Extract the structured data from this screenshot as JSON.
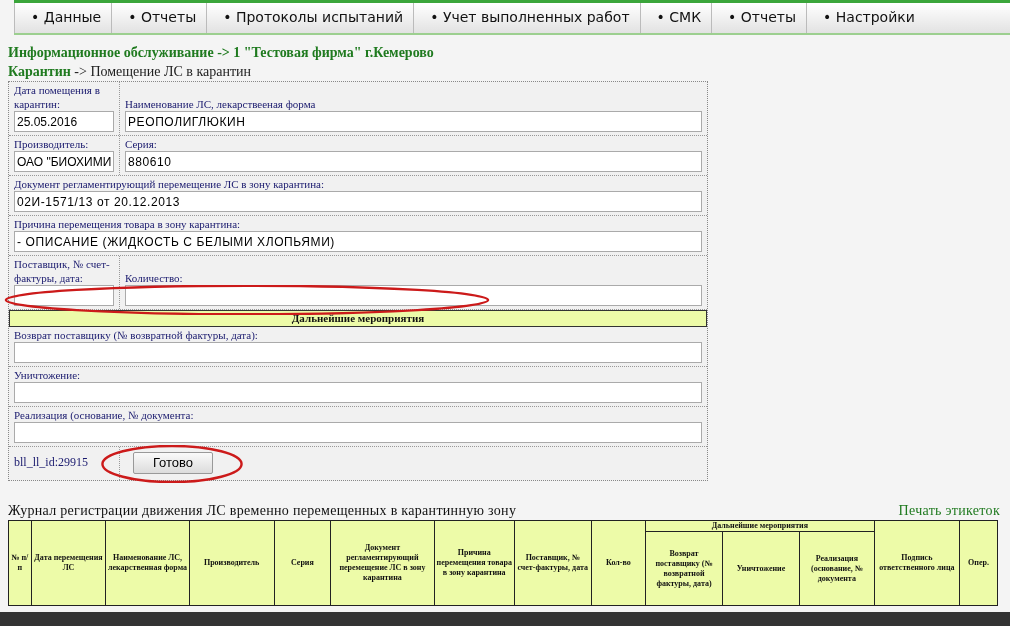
{
  "nav": [
    {
      "label": "• Данные"
    },
    {
      "label": "• Отчеты"
    },
    {
      "label": "• Протоколы испытаний"
    },
    {
      "label": "• Учет выполненных работ"
    },
    {
      "label": "• СМК"
    },
    {
      "label": "• Отчеты"
    },
    {
      "label": "• Настройки"
    }
  ],
  "breadcrumbs": [
    {
      "link": "Информационное обслуживание",
      "rest": "-> 1 \"Тестовая фирма\" г.Кемерово",
      "bold_rest": true
    },
    {
      "link": "Карантин",
      "rest": "-> Помещение ЛС в карантин",
      "bold_rest": false
    }
  ],
  "form": {
    "rows": [
      {
        "fields": [
          {
            "label": "Дата помещения в карантин:",
            "value": "25.05.2016",
            "kind": "narrow"
          },
          {
            "label": "Наименование ЛС, лекарствееная форма",
            "value": "РЕОПОЛИГЛЮКИН",
            "kind": "wide"
          }
        ]
      },
      {
        "fields": [
          {
            "label": "Производитель:",
            "value": "ОАО \"БИОХИМИ",
            "kind": "narrow"
          },
          {
            "label": "Серия:",
            "value": "880610",
            "kind": "wide"
          }
        ]
      },
      {
        "fields": [
          {
            "label": "Документ регламентирующий перемещение ЛС в зону карантина:",
            "value": "02И-1571/13 от 20.12.2013",
            "kind": "wide"
          }
        ]
      },
      {
        "fields": [
          {
            "label": "Причина перемещения товара в зону карантина:",
            "value": "- ОПИСАНИЕ (ЖИДКОСТЬ С БЕЛЫМИ ХЛОПЬЯМИ)",
            "kind": "wide"
          }
        ]
      },
      {
        "circled": true,
        "fields": [
          {
            "label": "Поставщик, № счет-фактуры, дата:",
            "kind": "narrow"
          },
          {
            "label": "Количество:",
            "kind": "wide"
          }
        ]
      }
    ],
    "section_title": "Дальнейшие мероприятия",
    "followup": [
      {
        "label": "Возврат поставщику (№ возвратной фактуры, дата):"
      },
      {
        "label": "Уничтожение:"
      },
      {
        "label": "Реализация (основание, № документа:"
      }
    ],
    "record_id": "bll_ll_id:29915",
    "submit": {
      "label": "Готово",
      "circled": true
    }
  },
  "journal": {
    "title": "Журнал регистрации движения ЛС временно перемещенных в карантинную зону",
    "print_link": "Печать этикеток",
    "columns": [
      {
        "label": "№ п/п"
      },
      {
        "label": "Дата перемещения ЛС"
      },
      {
        "label": "Наименование ЛС, лекарственная форма"
      },
      {
        "label": "Производитель"
      },
      {
        "label": "Серия"
      },
      {
        "label": "Документ регламентирующий перемещение ЛС в зону карантина"
      },
      {
        "label": "Причина перемещения товара в зону карантина"
      },
      {
        "label": "Поставщик, № счет-фактуры, дата"
      },
      {
        "label": "Кол-во"
      },
      {
        "label": "Дальнейшие мероприятия",
        "children": [
          {
            "label": "Возврат поставщику (№ возвратной фактуры, дата)"
          },
          {
            "label": "Уничтожение"
          },
          {
            "label": "Реализация (основание, № документа"
          }
        ]
      },
      {
        "label": "Подпись ответственного лица"
      },
      {
        "label": "Опер."
      }
    ]
  }
}
